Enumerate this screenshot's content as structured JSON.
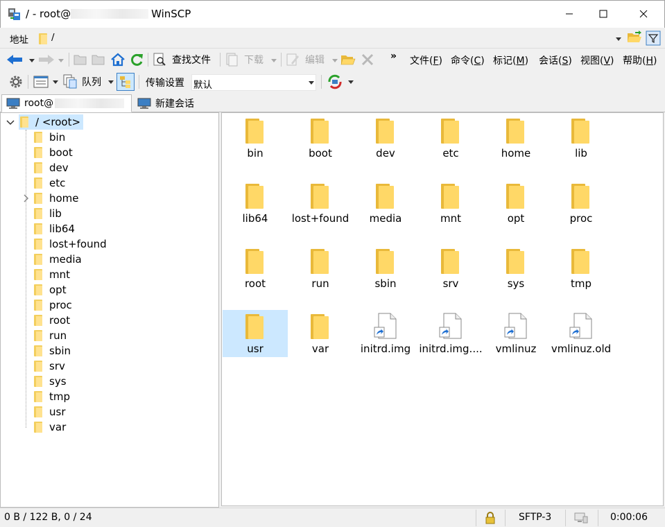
{
  "window": {
    "title_prefix": "/ - root@",
    "title_suffix": "WinSCP",
    "minimize_glyph": "minimize",
    "maximize_glyph": "maximize",
    "close_glyph": "close"
  },
  "address": {
    "label": "地址",
    "path": "/"
  },
  "toolbar1": {
    "find_files": "查找文件",
    "download": "下载",
    "edit": "编辑",
    "chevron": "»",
    "menus": [
      {
        "text": "文件(",
        "key": "F",
        "end": ")"
      },
      {
        "text": "命令(",
        "key": "C",
        "end": ")"
      },
      {
        "text": "标记(",
        "key": "M",
        "end": ")"
      },
      {
        "text": "会话(",
        "key": "S",
        "end": ")"
      },
      {
        "text": "视图(",
        "key": "V",
        "end": ")"
      },
      {
        "text": "帮助(",
        "key": "H",
        "end": ")"
      }
    ]
  },
  "toolbar2": {
    "queue": "队列",
    "transfer_settings": "传输设置",
    "preset": "默认"
  },
  "tabs": {
    "session": "root@",
    "new_session": "新建会话"
  },
  "tree": {
    "root": "/ <root>",
    "items": [
      "bin",
      "boot",
      "dev",
      "etc",
      "home",
      "lib",
      "lib64",
      "lost+found",
      "media",
      "mnt",
      "opt",
      "proc",
      "root",
      "run",
      "sbin",
      "srv",
      "sys",
      "tmp",
      "usr",
      "var"
    ]
  },
  "files": {
    "items": [
      {
        "name": "bin",
        "type": "folder"
      },
      {
        "name": "boot",
        "type": "folder"
      },
      {
        "name": "dev",
        "type": "folder"
      },
      {
        "name": "etc",
        "type": "folder"
      },
      {
        "name": "home",
        "type": "folder"
      },
      {
        "name": "lib",
        "type": "folder"
      },
      {
        "name": "lib64",
        "type": "folder"
      },
      {
        "name": "lost+found",
        "type": "folder"
      },
      {
        "name": "media",
        "type": "folder"
      },
      {
        "name": "mnt",
        "type": "folder"
      },
      {
        "name": "opt",
        "type": "folder"
      },
      {
        "name": "proc",
        "type": "folder"
      },
      {
        "name": "root",
        "type": "folder"
      },
      {
        "name": "run",
        "type": "folder"
      },
      {
        "name": "sbin",
        "type": "folder"
      },
      {
        "name": "srv",
        "type": "folder"
      },
      {
        "name": "sys",
        "type": "folder"
      },
      {
        "name": "tmp",
        "type": "folder"
      },
      {
        "name": "usr",
        "type": "folder",
        "selected": true
      },
      {
        "name": "var",
        "type": "folder"
      },
      {
        "name": "initrd.img",
        "type": "link"
      },
      {
        "name": "initrd.img....",
        "type": "link"
      },
      {
        "name": "vmlinuz",
        "type": "link"
      },
      {
        "name": "vmlinuz.old",
        "type": "link"
      }
    ]
  },
  "status": {
    "selection": "0 B / 122 B,   0 / 24",
    "protocol": "SFTP-3",
    "elapsed": "0:00:06"
  },
  "colors": {
    "selection": "#cce8ff",
    "folder_back": "#e9b93a",
    "folder_front": "#ffd867",
    "nav_arrow": "#1e6fd1",
    "refresh": "#2aa12a"
  }
}
